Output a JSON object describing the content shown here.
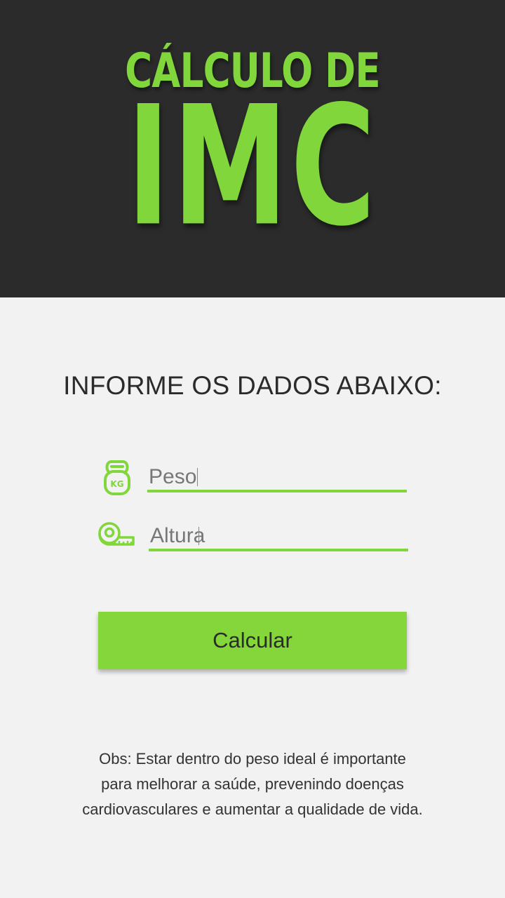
{
  "header": {
    "title_line1": "CÁLCULO DE",
    "title_line2": "IMC"
  },
  "form": {
    "heading": "INFORME OS DADOS ABAIXO:",
    "peso": {
      "placeholder": "Peso",
      "icon": "kettlebell-kg-icon",
      "icon_text": "KG"
    },
    "altura": {
      "placeholder": "Altura",
      "icon": "measuring-tape-icon"
    },
    "submit_label": "Calcular"
  },
  "note": {
    "line1": "Obs: Estar dentro do peso ideal é importante",
    "line2": "para melhorar a saúde, prevenindo doenças",
    "line3": "cardiovasculares e aumentar a qualidade de vida."
  },
  "colors": {
    "accent": "#80d63a",
    "header_bg": "#2b2b2b",
    "page_bg": "#f2f2f2",
    "text_dark": "#2b2b2b"
  }
}
